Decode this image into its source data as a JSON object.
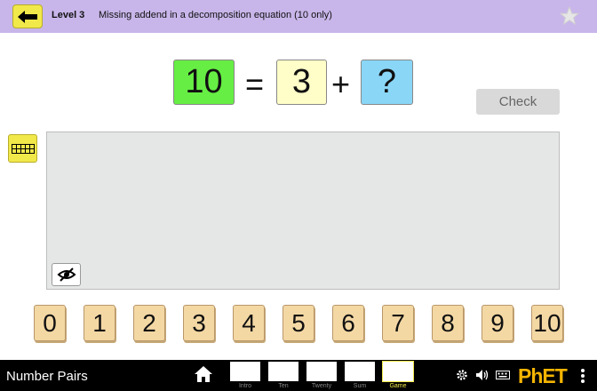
{
  "header": {
    "level_label": "Level 3",
    "description": "Missing addend in a decomposition equation (10 only)",
    "back_icon": "left-arrow-icon",
    "star_icon": "star-icon"
  },
  "equation": {
    "sum": "10",
    "equals": "=",
    "addend": "3",
    "plus": "+",
    "missing": "?"
  },
  "check_label": "Check",
  "number_buttons": [
    "0",
    "1",
    "2",
    "3",
    "4",
    "5",
    "6",
    "7",
    "8",
    "9",
    "10"
  ],
  "navbar": {
    "app_title": "Number Pairs",
    "screens": [
      "Intro",
      "Ten",
      "Twenty",
      "Sum",
      "Game"
    ],
    "active_screen": "Game"
  },
  "colors": {
    "header_bg": "#c8b6ea",
    "sum_box": "#66ee44",
    "addend_box": "#fffdc8",
    "missing_box": "#8ad6f7",
    "tile": "#f4d8a4",
    "accent_yellow": "#f1e84a"
  }
}
